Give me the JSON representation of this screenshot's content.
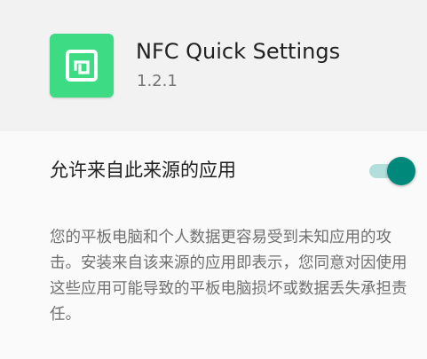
{
  "app": {
    "name": "NFC Quick Settings",
    "version": "1.2.1",
    "icon": "nfc-tag-icon",
    "icon_color": "#3ddc84"
  },
  "setting": {
    "label": "允许来自此来源的应用",
    "toggle_on": true,
    "accent_color": "#00897b"
  },
  "warning_text": "您的平板电脑和个人数据更容易受到未知应用的攻击。安装来自该来源的应用即表示，您同意对因使用这些应用可能导致的平板电脑损坏或数据丢失承担责任。"
}
